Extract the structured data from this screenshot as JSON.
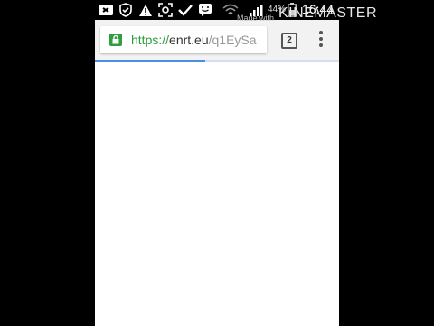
{
  "status_bar": {
    "time": "16:44",
    "battery_percent": "44%",
    "icons": [
      "notification-icon",
      "shield-icon",
      "warning-icon",
      "screenshot-icon",
      "check-icon",
      "chat-icon",
      "wifi-icon",
      "signal-icon",
      "battery-icon"
    ]
  },
  "watermark": {
    "small_text": "Made with",
    "brand_text": "KINEMASTER"
  },
  "browser": {
    "url_scheme": "https://",
    "url_host": "enrt.eu",
    "url_path": "/q1EySa",
    "tab_count": "2",
    "load_progress": 0.45,
    "accent_color": "#2e9e3f",
    "progress_color": "#4a90e2"
  }
}
